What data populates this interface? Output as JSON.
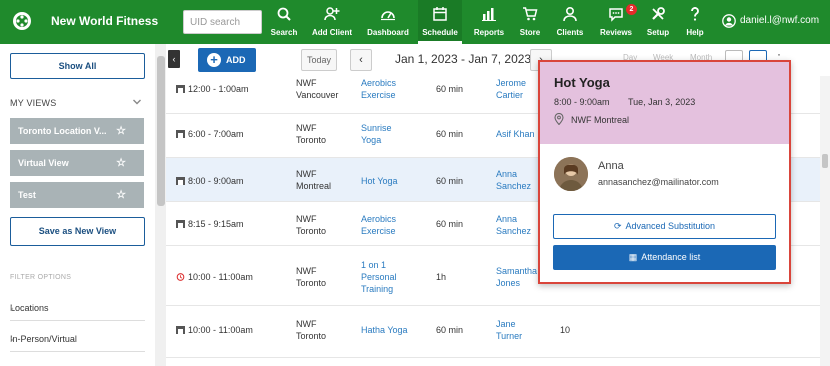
{
  "header": {
    "brand": "New World Fitness",
    "search_placeholder": "UID search",
    "nav": [
      {
        "label": "Search",
        "icon": "search-icon"
      },
      {
        "label": "Add Client",
        "icon": "add-user-icon"
      },
      {
        "label": "Dashboard",
        "icon": "dashboard-icon"
      },
      {
        "label": "Schedule",
        "icon": "calendar-icon"
      },
      {
        "label": "Reports",
        "icon": "bar-chart-icon"
      },
      {
        "label": "Store",
        "icon": "cart-icon"
      },
      {
        "label": "Clients",
        "icon": "person-icon"
      },
      {
        "label": "Reviews",
        "icon": "chat-bubble-icon",
        "badge": "2"
      },
      {
        "label": "Setup",
        "icon": "wrench-icon"
      },
      {
        "label": "Help",
        "icon": "question-icon"
      }
    ],
    "user_email": "daniel.l@nwf.com"
  },
  "sidebar": {
    "show_all": "Show All",
    "my_views_label": "MY VIEWS",
    "views": [
      "Toronto Location V...",
      "Virtual View",
      "Test"
    ],
    "save_view": "Save as New View",
    "filter_options_label": "FILTER OPTIONS",
    "filters": [
      "Locations",
      "In-Person/Virtual"
    ]
  },
  "toolbar": {
    "add_label": "ADD",
    "today_label": "Today",
    "date_range": "Jan 1, 2023 - Jan 7, 2023",
    "view_tabs": [
      "Day",
      "Week",
      "Month"
    ]
  },
  "schedule": {
    "rows": [
      {
        "time": "12:00 - 1:00am",
        "location": [
          "NWF",
          "Vancouver"
        ],
        "class": [
          "Aerobics",
          "Exercise"
        ],
        "duration": "60 min",
        "staff": [
          "Jerome",
          "Cartier"
        ],
        "count": ""
      },
      {
        "time": "6:00 - 7:00am",
        "location": [
          "NWF",
          "Toronto"
        ],
        "class": [
          "Sunrise",
          "Yoga"
        ],
        "duration": "60 min",
        "staff": [
          "Asif Khan"
        ],
        "count": ""
      },
      {
        "time": "8:00 - 9:00am",
        "location": [
          "NWF",
          "Montreal"
        ],
        "class": [
          "Hot Yoga"
        ],
        "duration": "60 min",
        "staff": [
          "Anna",
          "Sanchez"
        ],
        "count": ""
      },
      {
        "time": "8:15 - 9:15am",
        "location": [
          "NWF",
          "Toronto"
        ],
        "class": [
          "Aerobics",
          "Exercise"
        ],
        "duration": "60 min",
        "staff": [
          "Anna",
          "Sanchez"
        ],
        "count": ""
      },
      {
        "time": "10:00 - 11:00am",
        "location": [
          "NWF",
          "Toronto"
        ],
        "class": [
          "1 on 1",
          "Personal",
          "Training"
        ],
        "duration": "1h",
        "staff": [
          "Samantha",
          "Jones"
        ],
        "count": ""
      },
      {
        "time": "10:00 - 11:00am",
        "location": [
          "NWF",
          "Toronto"
        ],
        "class": [
          "Hatha Yoga"
        ],
        "duration": "60 min",
        "staff": [
          "Jane",
          "Turner"
        ],
        "count": "10"
      }
    ]
  },
  "popover": {
    "title": "Hot Yoga",
    "time": "8:00 - 9:00am",
    "date": "Tue, Jan 3, 2023",
    "location": "NWF Montreal",
    "instructor_name": "Anna",
    "instructor_email": "annasanchez@mailinator.com",
    "advanced_substitution": "Advanced Substitution",
    "attendance_list": "Attendance list",
    "header_color": "#e4c1de"
  },
  "colors": {
    "nav_green": "#1f8a2c",
    "primary_blue": "#1b68b5",
    "highlight": "#d9453b"
  }
}
